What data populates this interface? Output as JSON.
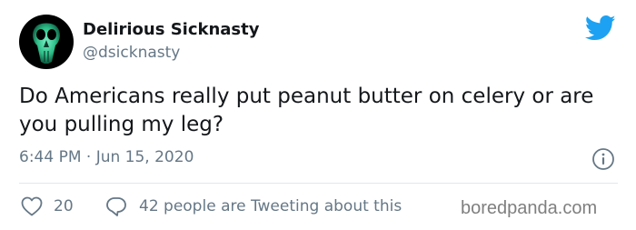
{
  "author": {
    "display_name": "Delirious Sicknasty",
    "handle": "@dsicknasty",
    "avatar_icon": "bird-skull-avatar"
  },
  "tweet": {
    "text": "Do Americans really put peanut butter on celery or are you pulling my leg?",
    "timestamp": "6:44 PM · Jun 15, 2020"
  },
  "engagement": {
    "like_count": "20",
    "reply_label": "42 people are Tweeting about this"
  },
  "icons": {
    "brand": "twitter-bird-icon",
    "info": "info-icon",
    "like": "heart-icon",
    "reply": "reply-bubble-icon"
  },
  "watermark": "boredpanda.com",
  "colors": {
    "twitter_blue": "#1da1f2",
    "text_primary": "#14171a",
    "text_secondary": "#657786",
    "avatar_bg": "#000000",
    "avatar_skull": "#3fd6a0",
    "divider": "#e1e8ed"
  }
}
